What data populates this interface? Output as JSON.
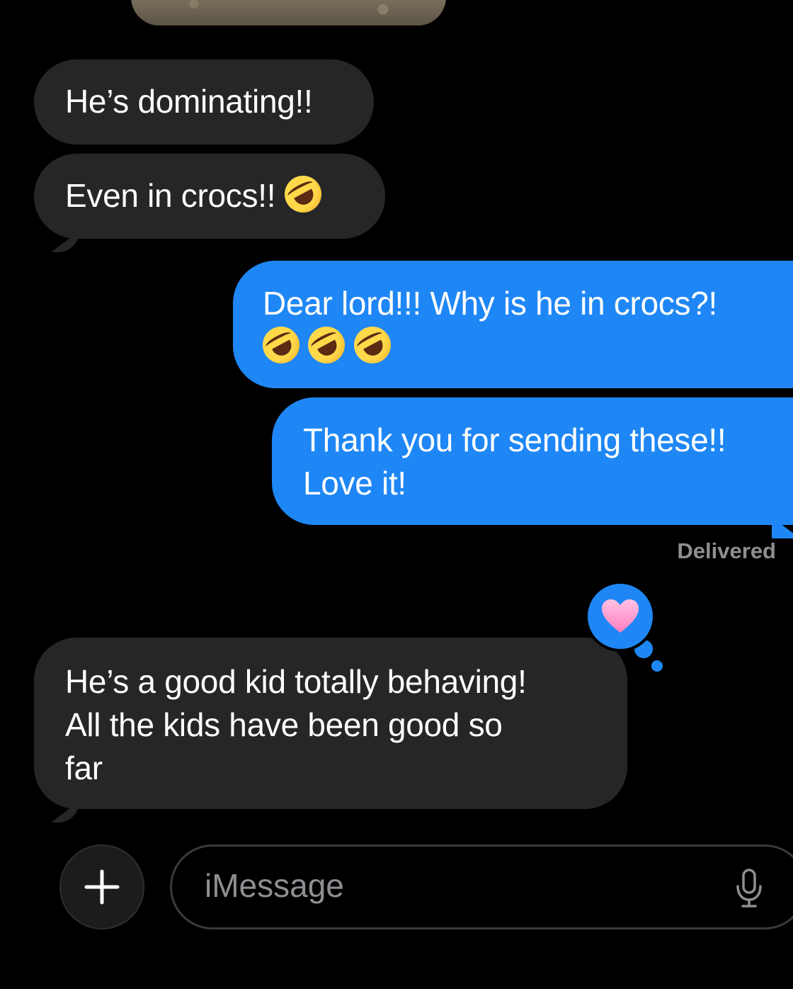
{
  "messages": [
    {
      "id": "m1",
      "direction": "incoming",
      "text": "He’s dominating!!"
    },
    {
      "id": "m2",
      "direction": "incoming",
      "text": "Even in crocs!!",
      "emoji_count": 1,
      "emoji_name": "rolling-on-floor-laughing"
    },
    {
      "id": "m3",
      "direction": "outgoing",
      "text": "Dear lord!!! Why is he in crocs?!",
      "emoji_count": 3,
      "emoji_name": "rolling-on-floor-laughing"
    },
    {
      "id": "m4",
      "direction": "outgoing",
      "lines": [
        "Thank you for sending these!!",
        "Love it!"
      ]
    },
    {
      "id": "m5",
      "direction": "incoming",
      "lines": [
        "He’s a good kid totally behaving!",
        "All the kids have been good so",
        "far"
      ],
      "reaction": "heart"
    }
  ],
  "status": {
    "delivered_label": "Delivered"
  },
  "composer": {
    "plus_label": "+",
    "placeholder": "iMessage",
    "mic_icon": "microphone-icon"
  },
  "colors": {
    "incoming_bubble": "#262628",
    "outgoing_bubble": "#1f87f5",
    "background": "#000000",
    "reaction_heart": "#ff9fd2"
  }
}
